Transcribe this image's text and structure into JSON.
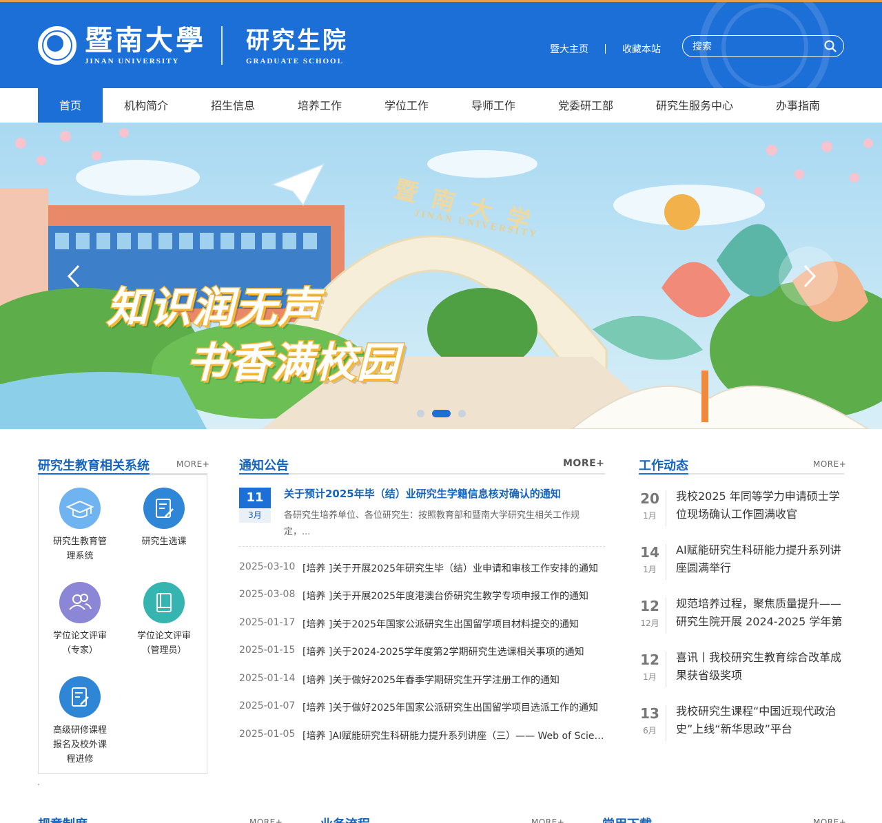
{
  "header": {
    "logo_cn": "暨南大學",
    "logo_en": "JINAN UNIVERSITY",
    "school_cn": "研究生院",
    "school_en": "GRADUATE SCHOOL",
    "top_links": [
      "暨大主页",
      "收藏本站"
    ],
    "search_placeholder": "搜索",
    "brand_color": "#1d6fd8"
  },
  "nav": {
    "items": [
      "首页",
      "机构简介",
      "招生信息",
      "培养工作",
      "学位工作",
      "导师工作",
      "党委研工部",
      "研究生服务中心",
      "办事指南"
    ],
    "active_index": 0
  },
  "banner": {
    "line1": "知识润无声",
    "line2": "书香满校园",
    "arch_cn": "暨南大学",
    "arch_en": "JINAN UNIVERSITY",
    "slide_count": 3,
    "active_slide": 1
  },
  "systems": {
    "title": "研究生教育相关系统",
    "more": "MORE+",
    "items": [
      {
        "label": "研究生教育管理系统",
        "icon": "graduation-cap-icon",
        "color": "#6fb3f0"
      },
      {
        "label": "研究生选课",
        "icon": "edit-list-icon",
        "color": "#2f86d6"
      },
      {
        "label": "学位论文评审（专家）",
        "icon": "users-icon",
        "color": "#8b86d6"
      },
      {
        "label": "学位论文评审（管理员）",
        "icon": "book-icon",
        "color": "#36b5b0"
      },
      {
        "label": "高级研修课程报名及校外课程进修",
        "icon": "edit-form-icon",
        "color": "#2f86d6"
      }
    ]
  },
  "notices": {
    "title": "通知公告",
    "more": "MORE+",
    "feature": {
      "day": "11",
      "month": "3月",
      "title": "关于预计2025年毕（结）业研究生学籍信息核对确认的通知",
      "summary": "各研究生培养单位、各位研究生：按照教育部和暨南大学研究生相关工作规定，..."
    },
    "items": [
      {
        "date": "2025-03-10",
        "title": "[培养 ]关于开展2025年研究生毕（结）业申请和审核工作安排的通知"
      },
      {
        "date": "2025-03-08",
        "title": "[培养 ]关于开展2025年度港澳台侨研究生教学专项申报工作的通知"
      },
      {
        "date": "2025-01-17",
        "title": "[培养 ]关于2025年国家公派研究生出国留学项目材料提交的通知"
      },
      {
        "date": "2025-01-15",
        "title": "[培养 ]关于2024-2025学年度第2学期研究生选课相关事项的通知"
      },
      {
        "date": "2025-01-14",
        "title": "[培养 ]关于做好2025年春季学期研究生开学注册工作的通知"
      },
      {
        "date": "2025-01-07",
        "title": "[培养 ]关于做好2025年国家公派研究生出国留学项目选派工作的通知"
      },
      {
        "date": "2025-01-05",
        "title": "[培养 ]AI赋能研究生科研能力提升系列讲座（三）—— Web of Science"
      }
    ]
  },
  "news": {
    "title": "工作动态",
    "more": "MORE+",
    "items": [
      {
        "day": "20",
        "month": "1月",
        "title": "我校2025 年同等学力申请硕士学位现场确认工作圆满收官"
      },
      {
        "day": "14",
        "month": "1月",
        "title": "AI赋能研究生科研能力提升系列讲座圆满举行"
      },
      {
        "day": "12",
        "month": "12月",
        "title": "规范培养过程，聚焦质量提升——研究生院开展 2024-2025 学年第"
      },
      {
        "day": "12",
        "month": "1月",
        "title": "喜讯丨我校研究生教育综合改革成果获省级奖项"
      },
      {
        "day": "13",
        "month": "6月",
        "title": "我校研究生课程“中国近现代政治史”上线“新华思政”平台"
      }
    ]
  },
  "bottom_sections": [
    {
      "title": "规章制度",
      "more": "MORE+"
    },
    {
      "title": "业务流程",
      "more": "MORE+"
    },
    {
      "title": "常用下载",
      "more": "MORE+"
    }
  ]
}
